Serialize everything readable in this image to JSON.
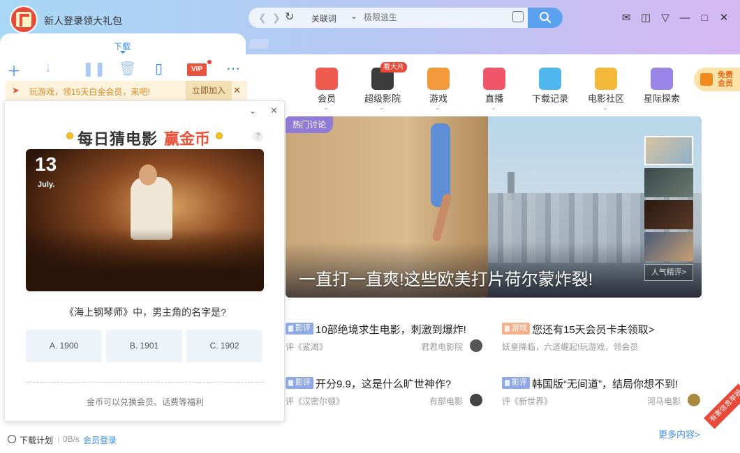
{
  "title_bar": {
    "promo": "新人登录领大礼包",
    "search_kind": "关联词",
    "search_placeholder": "极限逃生"
  },
  "left_panel": {
    "tab_label": "下载",
    "banner_text": "玩游戏，领15天白金会员，来吧!",
    "banner_join": "立即加入",
    "vip_label": "VIP"
  },
  "quiz": {
    "title": "每日猜电影",
    "title_highlight": "赢金币",
    "help": "?",
    "day": "13",
    "month": "July.",
    "question": "《海上钢琴师》中，男主角的名字是?",
    "options": [
      "A. 1900",
      "B. 1901",
      "C. 1902"
    ],
    "note": "金币可以兑换会员、话费等福利"
  },
  "status_bar": {
    "plan": "下载计划",
    "speed": "0B/s",
    "login": "会员登录"
  },
  "categories": [
    {
      "label": "会员",
      "tag": "",
      "color": "#ef5b4e"
    },
    {
      "label": "超级影院",
      "tag": "看大片",
      "color": "#3b3b3b"
    },
    {
      "label": "游戏",
      "tag": "",
      "color": "#f39a3c"
    },
    {
      "label": "直播",
      "tag": "",
      "color": "#f05668"
    },
    {
      "label": "下载记录",
      "tag": "",
      "color": "#4fb7ee"
    },
    {
      "label": "电影社区",
      "tag": "",
      "color": "#f4b83a"
    },
    {
      "label": "星际探索",
      "tag": "",
      "color": "#9a86e8"
    }
  ],
  "free_vip": {
    "line1": "免费",
    "line2": "会员"
  },
  "hero": {
    "tag": "热门讨论",
    "title": "一直打一直爽!这些欧美打片荷尔蒙炸裂!",
    "popular": "人气精评>"
  },
  "news": [
    {
      "badge": "影评",
      "badge_color": "#8ea9e6",
      "headline": "10部绝境求生电影，刺激到爆炸!",
      "sub": "评《鲨滩》",
      "source": "君君电影院",
      "avatar_color": "#555"
    },
    {
      "badge": "游戏",
      "badge_color": "#f4b08a",
      "headline": "您还有15天会员卡未领取>",
      "sub": "妖皇降临，六道崛起!玩游戏，领会员",
      "source": "",
      "avatar_color": ""
    },
    {
      "badge": "影评",
      "badge_color": "#8ea9e6",
      "headline": "开分9.9，这是什么旷世神作?",
      "sub": "评《汉密尔顿》",
      "source": "有部电影",
      "avatar_color": "#444"
    },
    {
      "badge": "影评",
      "badge_color": "#8ea9e6",
      "headline": "韩国版“无间道”，结局你想不到!",
      "sub": "评《新世界》",
      "source": "河马电影",
      "avatar_color": "#a88a3a"
    }
  ],
  "more": "更多内容>",
  "report": "有害信息举报"
}
